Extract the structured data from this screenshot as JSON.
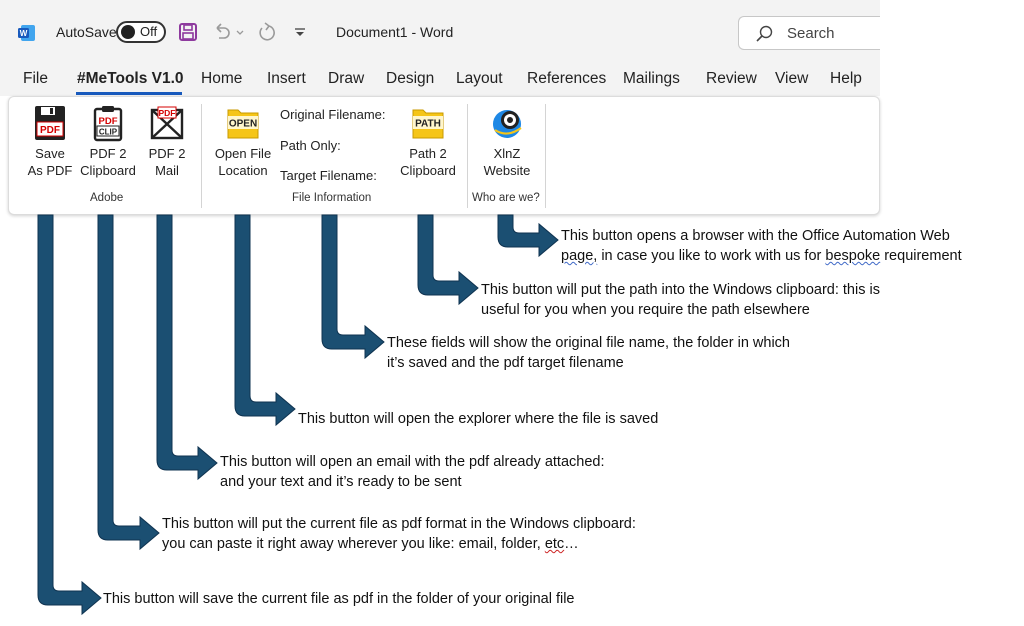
{
  "titlebar": {
    "autosave_label": "AutoSave",
    "autosave_state": "Off",
    "document_title": "Document1  -  Word",
    "search_placeholder": "Search"
  },
  "tabs": [
    "File",
    "#MeTools V1.0",
    "Home",
    "Insert",
    "Draw",
    "Design",
    "Layout",
    "References",
    "Mailings",
    "Review",
    "View",
    "Help"
  ],
  "ribbon": {
    "adobe": {
      "group_label": "Adobe",
      "save_pdf": {
        "line1": "Save",
        "line2": "As PDF",
        "icon_text": "PDF"
      },
      "pdf_clipboard": {
        "line1": "PDF 2",
        "line2": "Clipboard",
        "icon_text1": "PDF",
        "icon_text2": "CLIP"
      },
      "pdf_mail": {
        "line1": "PDF 2",
        "line2": "Mail",
        "icon_text": "PDF"
      }
    },
    "file_info": {
      "group_label": "File Information",
      "open_location": {
        "line1": "Open File",
        "line2": "Location",
        "icon_text": "OPEN"
      },
      "original_filename": "Original Filename:",
      "path_only": "Path Only:",
      "target_filename": "Target Filename:",
      "path_clipboard": {
        "line1": "Path 2",
        "line2": "Clipboard",
        "icon_text": "PATH"
      }
    },
    "who": {
      "group_label": "Who are we?",
      "website": {
        "line1": "XlnZ",
        "line2": "Website"
      }
    }
  },
  "callouts": {
    "website": {
      "l1_a": "This button opens a browser with the Office Automation Web",
      "l2_a": "page,",
      "l2_b": " in case you like to work with us for ",
      "l2_c": "bespoke",
      "l2_d": " requirement"
    },
    "path": {
      "l1": "This button will put the path into the Windows clipboard: this is",
      "l2": "useful for you when you require the path elsewhere"
    },
    "fields": {
      "l1": "These fields will show the original file name, the folder in which",
      "l2": "it’s saved and the pdf target filename"
    },
    "open": {
      "l1": "This button will open the explorer where the file is saved"
    },
    "mail": {
      "l1": "This button will open an email with the pdf already attached:",
      "l2": "and your text and it’s ready to be sent"
    },
    "clipboard": {
      "l1": "This button will put the current file as pdf format in the Windows clipboard:",
      "l2_a": "you can paste it right away wherever you like: email, folder, ",
      "l2_b": "etc",
      "l2_c": "…"
    },
    "save": {
      "l1": "This button will save the current file as pdf in the folder of your original file"
    }
  },
  "colors": {
    "arrow": "#1b4f72",
    "accent": "#185abd",
    "pdf_red": "#d40000",
    "folder_yellow": "#f5c518"
  }
}
